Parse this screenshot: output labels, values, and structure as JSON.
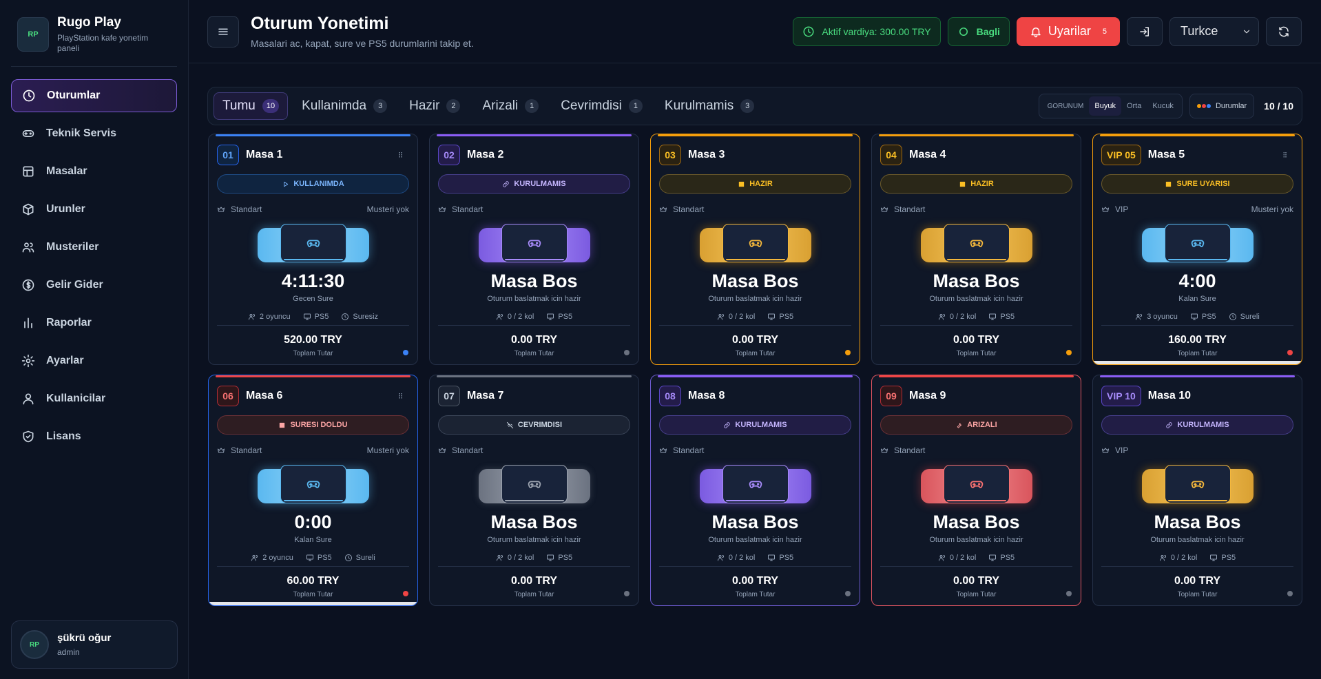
{
  "brand": {
    "name": "Rugo Play",
    "subtitle": "PlayStation kafe yonetim paneli",
    "logo_text": "RP"
  },
  "nav": [
    {
      "label": "Oturumlar",
      "icon": "clock-icon",
      "active": true
    },
    {
      "label": "Teknik Servis",
      "icon": "gamepad-icon"
    },
    {
      "label": "Masalar",
      "icon": "table-icon"
    },
    {
      "label": "Urunler",
      "icon": "box-icon"
    },
    {
      "label": "Musteriler",
      "icon": "users-icon"
    },
    {
      "label": "Gelir Gider",
      "icon": "dollar-icon"
    },
    {
      "label": "Raporlar",
      "icon": "chart-icon"
    },
    {
      "label": "Ayarlar",
      "icon": "gear-icon"
    },
    {
      "label": "Kullanicilar",
      "icon": "user-icon"
    },
    {
      "label": "Lisans",
      "icon": "shield-check-icon"
    }
  ],
  "user": {
    "name": "şükrü oğur",
    "role": "admin"
  },
  "header": {
    "title": "Oturum Yonetimi",
    "subtitle": "Masalari ac, kapat, sure ve PS5 durumlarini takip et.",
    "shift": "Aktif vardiya: 300.00 TRY",
    "connection": "Bagli",
    "alerts_label": "Uyarilar",
    "alerts_count": "5",
    "language": "Turkce"
  },
  "filters": [
    {
      "label": "Tumu",
      "count": "10",
      "active": true
    },
    {
      "label": "Kullanimda",
      "count": "3"
    },
    {
      "label": "Hazir",
      "count": "2"
    },
    {
      "label": "Arizali",
      "count": "1"
    },
    {
      "label": "Cevrimdisi",
      "count": "1"
    },
    {
      "label": "Kurulmamis",
      "count": "3"
    }
  ],
  "view": {
    "label": "GORUNUM",
    "options": [
      "Buyuk",
      "Orta",
      "Kucuk"
    ],
    "selected": "Buyuk",
    "status_label": "Durumlar",
    "page_count": "10 / 10"
  },
  "labels": {
    "total": "Toplam Tutar",
    "empty": "Masa Bos",
    "empty_sub": "Oturum baslatmak icin hazir"
  },
  "colors": {
    "blue": "#3b82f6",
    "purple": "#8b5cf6",
    "orange": "#f59e0b",
    "red": "#ef4444",
    "gray": "#6b7280",
    "green": "#4ade80"
  },
  "cards": [
    {
      "num": "01",
      "name": "Masa 1",
      "status": "KULLANIMDA",
      "theme": "blue",
      "status_icon": "play-icon",
      "type": "Standart",
      "customer": "Musteri yok",
      "time": "4:11:30",
      "time_label": "Gecen Sure",
      "players": "2 oyuncu",
      "console": "PS5",
      "mode": "Suresiz",
      "total": "520.00 TRY",
      "dot": "blue",
      "menu": true
    },
    {
      "num": "02",
      "name": "Masa 2",
      "status": "KURULMAMIS",
      "theme": "purple",
      "status_icon": "link-icon",
      "type": "Standart",
      "customer": "",
      "players": "0 / 2 kol",
      "console": "PS5",
      "total": "0.00 TRY",
      "dot": "gray"
    },
    {
      "num": "03",
      "name": "Masa 3",
      "status": "HAZIR",
      "theme": "orange",
      "status_icon": "square-icon",
      "type": "Standart",
      "customer": "",
      "players": "0 / 2 kol",
      "console": "PS5",
      "total": "0.00 TRY",
      "dot": "orange",
      "highlight": true
    },
    {
      "num": "04",
      "name": "Masa 4",
      "status": "HAZIR",
      "theme": "orange",
      "status_icon": "square-icon",
      "type": "Standart",
      "customer": "",
      "players": "0 / 2 kol",
      "console": "PS5",
      "total": "0.00 TRY",
      "dot": "orange"
    },
    {
      "num": "VIP 05",
      "name": "Masa 5",
      "status": "SURE UYARISI",
      "theme": "orange",
      "console_theme": "blue",
      "status_icon": "square-icon",
      "type": "VIP",
      "customer": "Musteri yok",
      "time": "4:00",
      "time_label": "Kalan Sure",
      "players": "3 oyuncu",
      "console": "PS5",
      "mode": "Sureli",
      "total": "160.00 TRY",
      "dot": "red",
      "menu": true,
      "highlight": true,
      "bottom_bar": true
    },
    {
      "num": "06",
      "name": "Masa 6",
      "status": "SURESI DOLDU",
      "theme": "red",
      "console_theme": "blue",
      "status_icon": "square-icon",
      "type": "Standart",
      "customer": "Musteri yok",
      "time": "0:00",
      "time_label": "Kalan Sure",
      "players": "2 oyuncu",
      "console": "PS5",
      "mode": "Sureli",
      "total": "60.00 TRY",
      "dot": "red",
      "menu": true,
      "bluebox": true,
      "bottom_bar": true
    },
    {
      "num": "07",
      "name": "Masa 7",
      "status": "CEVRIMDISI",
      "theme": "gray",
      "status_icon": "wifi-off-icon",
      "type": "Standart",
      "customer": "",
      "players": "0 / 2 kol",
      "console": "PS5",
      "total": "0.00 TRY",
      "dot": "gray"
    },
    {
      "num": "08",
      "name": "Masa 8",
      "status": "KURULMAMIS",
      "theme": "purple",
      "status_icon": "link-icon",
      "type": "Standart",
      "customer": "",
      "players": "0 / 2 kol",
      "console": "PS5",
      "total": "0.00 TRY",
      "dot": "gray",
      "purplebox": true
    },
    {
      "num": "09",
      "name": "Masa 9",
      "status": "ARIZALI",
      "theme": "red",
      "status_icon": "wrench-icon",
      "type": "Standart",
      "customer": "",
      "players": "0 / 2 kol",
      "console": "PS5",
      "total": "0.00 TRY",
      "dot": "gray",
      "redbox": true
    },
    {
      "num": "VIP 10",
      "name": "Masa 10",
      "status": "KURULMAMIS",
      "theme": "purple",
      "console_theme": "orange",
      "status_icon": "link-icon",
      "type": "VIP",
      "customer": "",
      "players": "0 / 2 kol",
      "console": "PS5",
      "total": "0.00 TRY",
      "dot": "gray"
    }
  ]
}
